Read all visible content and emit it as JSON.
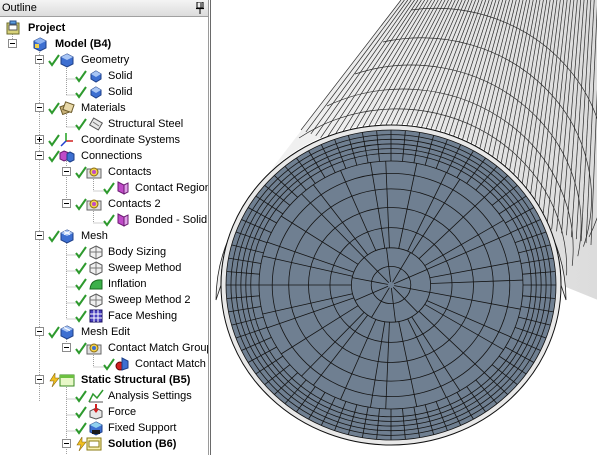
{
  "outline": {
    "title": "Outline",
    "items": [
      {
        "label": "Project",
        "bold": true
      },
      {
        "label": "Model (B4)",
        "bold": true
      },
      {
        "label": "Geometry"
      },
      {
        "label": "Solid"
      },
      {
        "label": "Solid"
      },
      {
        "label": "Materials"
      },
      {
        "label": "Structural Steel"
      },
      {
        "label": "Coordinate Systems"
      },
      {
        "label": "Connections"
      },
      {
        "label": "Contacts"
      },
      {
        "label": "Contact Region"
      },
      {
        "label": "Contacts 2"
      },
      {
        "label": "Bonded - Solid"
      },
      {
        "label": "Mesh"
      },
      {
        "label": "Body Sizing"
      },
      {
        "label": "Sweep Method"
      },
      {
        "label": "Inflation"
      },
      {
        "label": "Sweep Method 2"
      },
      {
        "label": "Face Meshing"
      },
      {
        "label": "Mesh Edit"
      },
      {
        "label": "Contact Match Group"
      },
      {
        "label": "Contact Match"
      },
      {
        "label": "Static Structural (B5)",
        "bold": true
      },
      {
        "label": "Analysis Settings"
      },
      {
        "label": "Force"
      },
      {
        "label": "Fixed Support"
      },
      {
        "label": "Solution (B6)",
        "bold": true
      }
    ]
  },
  "icons": {
    "pin": "pin-icon",
    "check": "check-icon",
    "project": "project-icon",
    "model": "model-cube-icon",
    "geometry": "geometry-icon",
    "solid": "solid-body-icon",
    "materials": "materials-icon",
    "material": "material-icon",
    "coordinate_systems": "coordinate-axes-icon",
    "connections": "connections-icon",
    "contacts": "contacts-icon",
    "contact_region": "contact-region-icon",
    "mesh": "mesh-icon",
    "mesh_control": "mesh-control-icon",
    "inflation": "inflation-icon",
    "face_meshing": "face-meshing-icon",
    "static_structural": "static-structural-icon",
    "analysis_settings": "analysis-settings-icon",
    "force": "force-icon",
    "fixed_support": "fixed-support-icon",
    "solution": "solution-icon"
  },
  "colors": {
    "check_green": "#2e9a2e",
    "face_fill": "#6f7f91",
    "mesh_line": "#1a1a1a",
    "cylinder_side": "#e9e9e9",
    "cube_blue": "#3d6fd1",
    "panel_border": "#9a9a9a"
  }
}
